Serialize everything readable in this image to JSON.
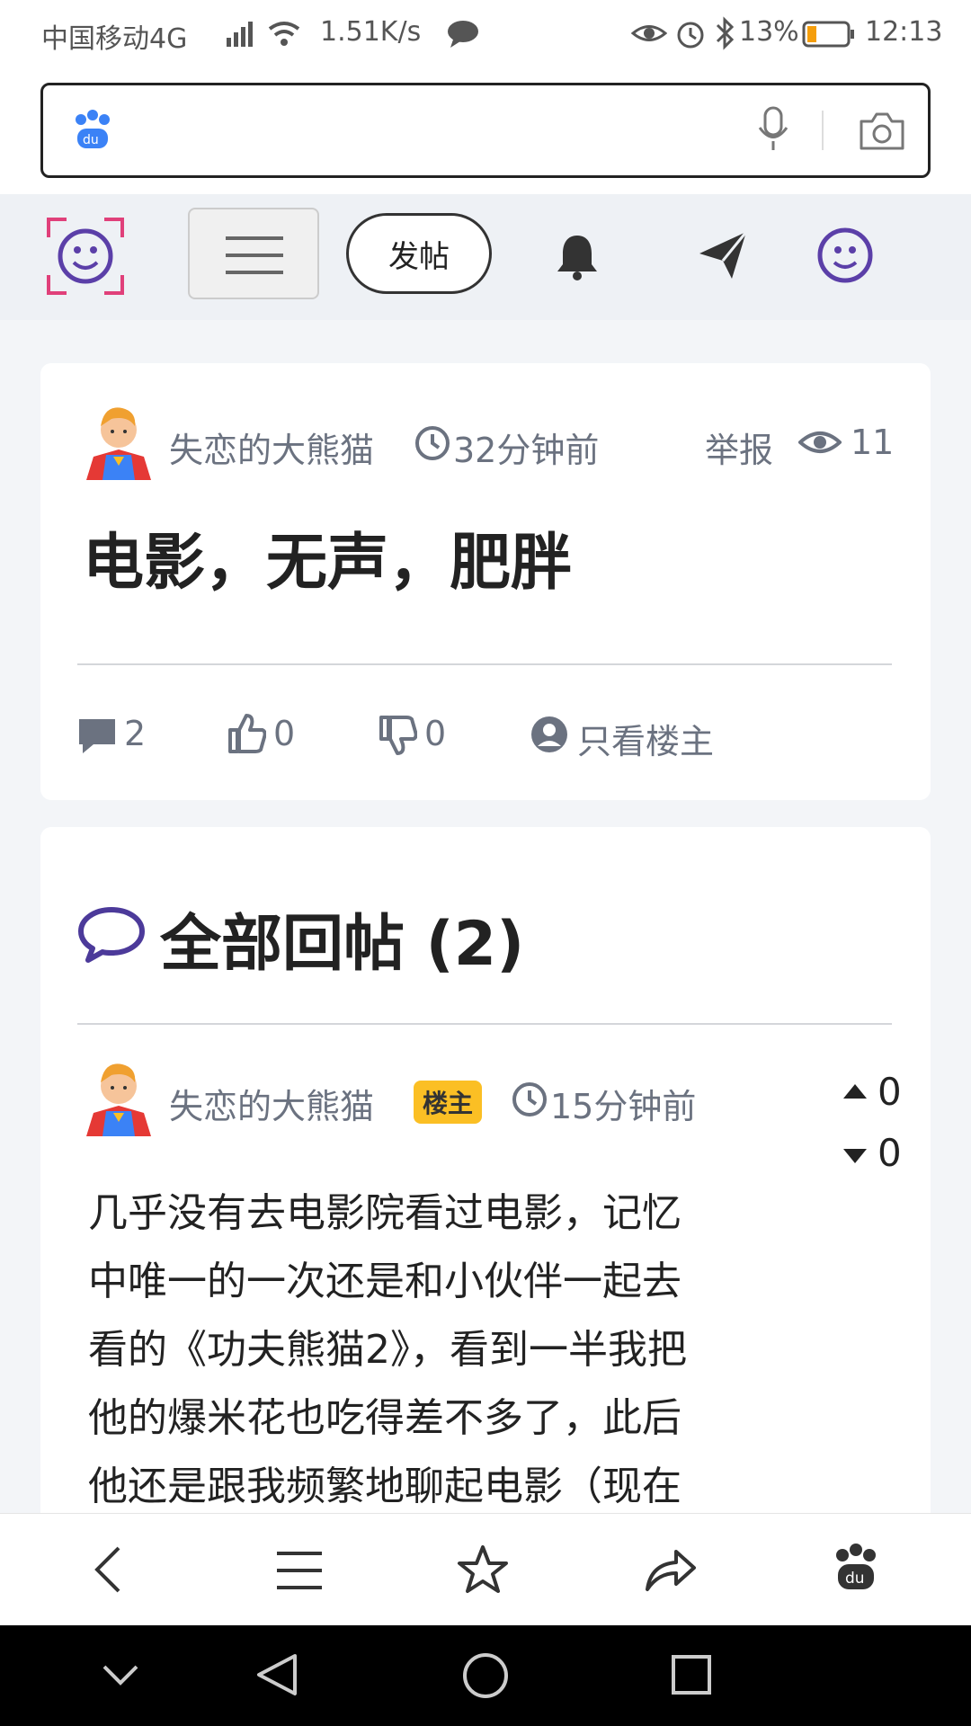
{
  "status": {
    "carrier": "中国移动4G",
    "net_speed": "1.51K/s",
    "battery": "13%",
    "time": "12:13"
  },
  "toolbar": {
    "post_label": "发帖"
  },
  "post": {
    "author": "失恋的大熊猫",
    "time": "32分钟前",
    "report": "举报",
    "views": "11",
    "title": "电影，无声，肥胖",
    "comments": "2",
    "likes": "0",
    "dislikes": "0",
    "only_op": "只看楼主"
  },
  "replies": {
    "heading": "全部回帖 (2)",
    "items": [
      {
        "author": "失恋的大熊猫",
        "badge": "楼主",
        "time": "15分钟前",
        "up": "0",
        "down": "0",
        "lines": [
          "几乎没有去电影院看过电影，记忆",
          "中唯一的一次还是和小伙伴一起去",
          "看的《功夫熊猫2》，看到一半我把",
          "他的爆米花也吃得差不多了，此后",
          "他还是跟我频繁地聊起电影（现在"
        ]
      }
    ]
  },
  "colors": {
    "accent": "#5b3fa8",
    "badge": "#fbbf24",
    "text_gray": "#6b7280"
  }
}
